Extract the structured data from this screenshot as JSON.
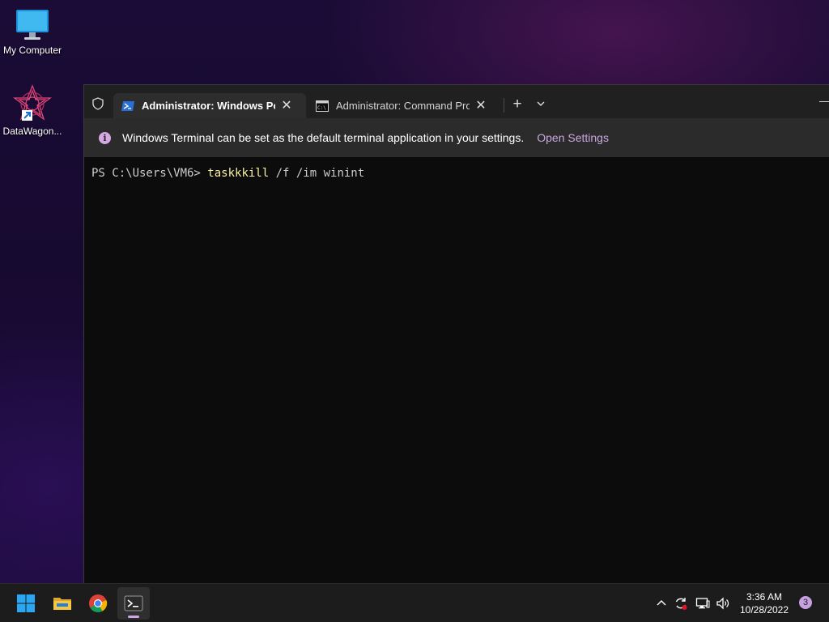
{
  "desktop": {
    "icons": [
      {
        "label": "My Computer",
        "icon": "monitor-icon"
      },
      {
        "label": "DataWagon...",
        "icon": "datawagon-logo-icon"
      }
    ]
  },
  "terminal": {
    "tabs": [
      {
        "title": "Administrator: Windows PowerShell",
        "icon": "powershell-icon",
        "active": true
      },
      {
        "title": "Administrator: Command Prompt",
        "icon": "cmd-icon",
        "active": false
      }
    ],
    "new_tab": "+",
    "infobar": {
      "message": "Windows Terminal can be set as the default terminal application in your settings.",
      "link": "Open Settings"
    },
    "console": {
      "prompt": "PS C:\\Users\\VM6> ",
      "command": "taskkkill",
      "args": " /f /im winint"
    }
  },
  "taskbar": {
    "apps": [
      "start-icon",
      "file-explorer-icon",
      "chrome-icon",
      "terminal-icon"
    ],
    "tray": [
      "chevron-up-icon",
      "sync-icon",
      "network-icon",
      "volume-icon"
    ],
    "time": "3:36 AM",
    "date": "10/28/2022",
    "notification_count": "3"
  },
  "colors": {
    "accent": "#d0a4e6",
    "prompt_command": "#f9f1a5",
    "console_bg": "#0c0c0c"
  }
}
